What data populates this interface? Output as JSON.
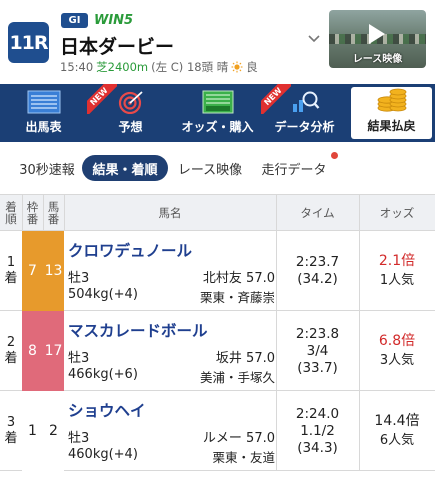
{
  "header": {
    "race_no": "11R",
    "grade": "GI",
    "win5": "WIN5",
    "title": "日本ダービー",
    "info_time": "15:40",
    "info_turf": "芝2400m",
    "info_rest": "(左 C) 18頭 晴",
    "info_going": "良",
    "video_caption": "レース映像"
  },
  "nav": {
    "items": [
      {
        "label": "出馬表"
      },
      {
        "label": "予想",
        "ribbon": "NEW"
      },
      {
        "label": "オッズ・購入"
      },
      {
        "label": "データ分析",
        "ribbon": "NEW"
      },
      {
        "label": "結果払戻"
      }
    ]
  },
  "subtabs": {
    "items": [
      {
        "label": "30秒速報"
      },
      {
        "label": "結果・着順"
      },
      {
        "label": "レース映像"
      },
      {
        "label": "走行データ"
      }
    ]
  },
  "table": {
    "headers": {
      "rank": [
        "着",
        "順"
      ],
      "frame": [
        "枠",
        "番"
      ],
      "num": [
        "馬",
        "番"
      ],
      "name": "馬名",
      "time": "タイム",
      "odds": "オッズ"
    },
    "rows": [
      {
        "rank": [
          "1",
          "着"
        ],
        "frame": "7",
        "num": "13",
        "name": "クロワデュノール",
        "sex_age": "牡3",
        "jockey": "北村友 57.0",
        "weight": "504kg(+4)",
        "trainer": "栗東・斉藤崇",
        "time": "2:23.7",
        "margin": "",
        "last3f": "(34.2)",
        "odds": "2.1倍",
        "pop": "1人気"
      },
      {
        "rank": [
          "2",
          "着"
        ],
        "frame": "8",
        "num": "17",
        "name": "マスカレードボール",
        "sex_age": "牡3",
        "jockey": "坂井 57.0",
        "weight": "466kg(+6)",
        "trainer": "美浦・手塚久",
        "time": "2:23.8",
        "margin": "3/4",
        "last3f": "(33.7)",
        "odds": "6.8倍",
        "pop": "3人気"
      },
      {
        "rank": [
          "3",
          "着"
        ],
        "frame": "1",
        "num": "2",
        "name": "ショウヘイ",
        "sex_age": "牡3",
        "jockey": "ルメー 57.0",
        "weight": "460kg(+4)",
        "trainer": "栗東・友道",
        "time": "2:24.0",
        "margin": "1.1/2",
        "last3f": "(34.3)",
        "odds": "14.4倍",
        "pop": "6人気"
      }
    ]
  },
  "colors": {
    "brand": "#1f4e8f",
    "nav_bg": "#1b3f75",
    "frame_7": "#e79a2c",
    "frame_8": "#e06a7a",
    "odds_high": "#d22a2a",
    "turf": "#2a9b3a"
  }
}
